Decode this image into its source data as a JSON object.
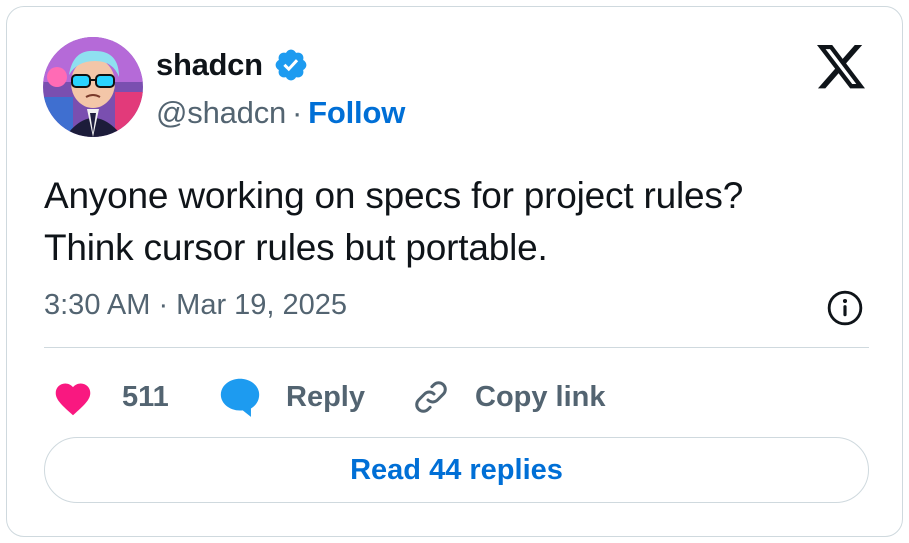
{
  "author": {
    "name": "shadcn",
    "handle": "@shadcn",
    "separator": "·",
    "follow_label": "Follow",
    "verified": true,
    "avatar_icon": "cartoon-avatar"
  },
  "brand": {
    "logo_icon": "x-logo"
  },
  "tweet": {
    "lines": [
      "Anyone working on specs for project rules?",
      "Think cursor rules but portable."
    ],
    "timestamp": "3:30 AM · Mar 19, 2025"
  },
  "actions": {
    "like_count": "511",
    "reply_label": "Reply",
    "copy_link_label": "Copy link"
  },
  "read_replies_label": "Read 44 replies",
  "colors": {
    "text": "#0f1419",
    "secondary": "#536471",
    "link": "#006fd6",
    "heart": "#f91880",
    "reply": "#1d9bf0",
    "verified": "#1d9bf0",
    "border": "#cfd9de"
  }
}
